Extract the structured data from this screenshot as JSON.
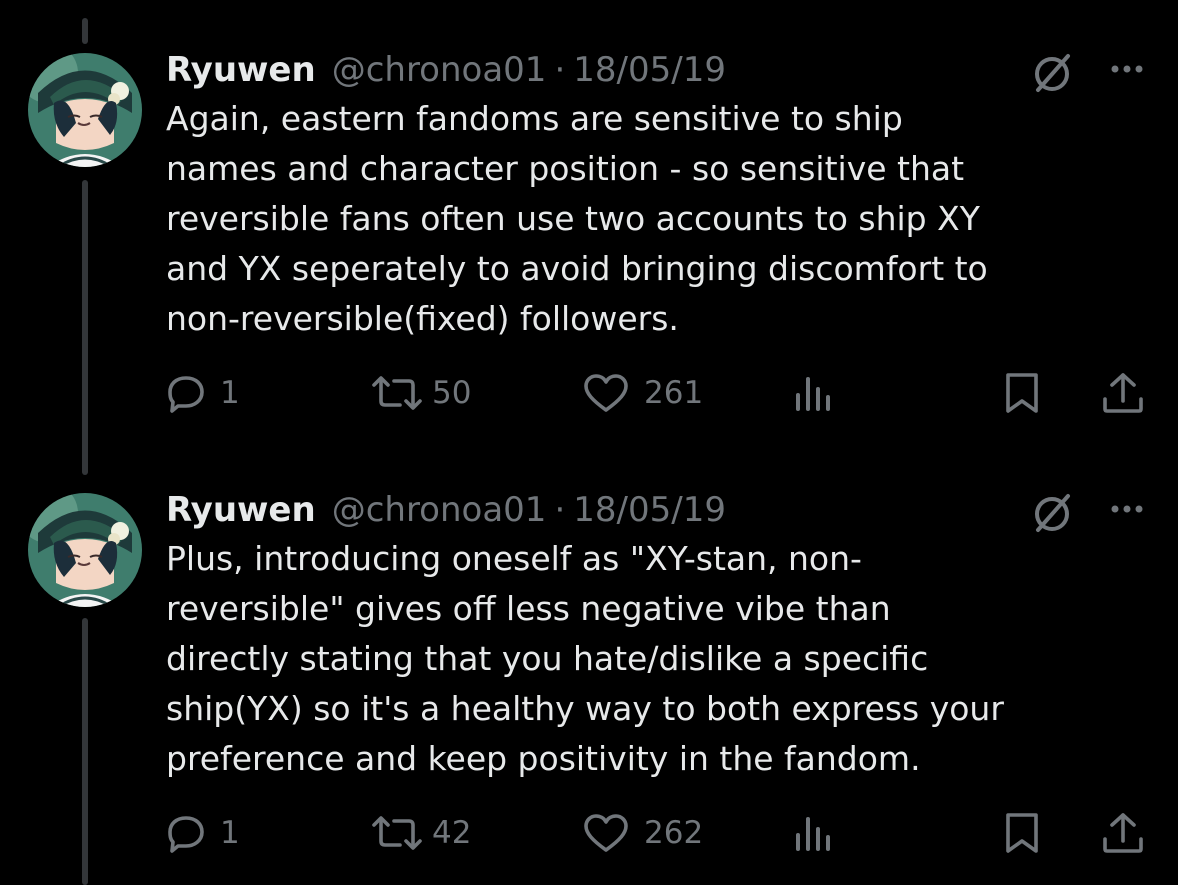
{
  "theme": {
    "background": "#000000",
    "text": "#e7e9ea",
    "secondary": "#71767b",
    "thread_line": "#333639"
  },
  "tweets": [
    {
      "display_name": "Ryuwen",
      "handle": "@chronoa01",
      "separator": "·",
      "date": "18/05/19",
      "text": "Again, eastern fandoms are sensitive to ship\nnames and character position - so sensitive that\nreversible fans often use two accounts to ship XY\nand YX seperately to avoid bringing discomfort to\nnon-reversible(fixed) followers.",
      "replies": "1",
      "retweets": "50",
      "likes": "261",
      "icons": [
        "avatar",
        "mute-icon",
        "more-icon",
        "reply-icon",
        "retweet-icon",
        "like-icon",
        "views-icon",
        "bookmark-icon",
        "share-icon"
      ]
    },
    {
      "display_name": "Ryuwen",
      "handle": "@chronoa01",
      "separator": "·",
      "date": "18/05/19",
      "text": "Plus, introducing oneself as \"XY-stan, non-\nreversible\" gives off less negative vibe than\ndirectly stating that you hate/dislike a specific\nship(YX) so it's a healthy way to both express your\npreference and keep positivity in the fandom.",
      "replies": "1",
      "retweets": "42",
      "likes": "262",
      "icons": [
        "avatar",
        "mute-icon",
        "more-icon",
        "reply-icon",
        "retweet-icon",
        "like-icon",
        "views-icon",
        "bookmark-icon",
        "share-icon"
      ]
    }
  ]
}
